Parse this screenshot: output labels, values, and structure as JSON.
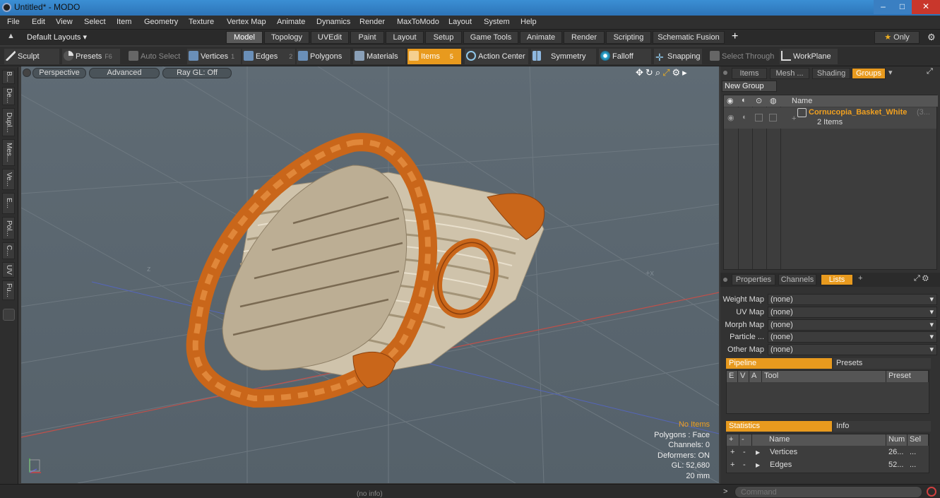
{
  "window": {
    "title": "Untitled* - MODO",
    "min": "–",
    "max": "□",
    "close": "✕"
  },
  "menu": [
    "File",
    "Edit",
    "View",
    "Select",
    "Item",
    "Geometry",
    "Texture",
    "Vertex Map",
    "Animate",
    "Dynamics",
    "Render",
    "MaxToModo",
    "Layout",
    "System",
    "Help"
  ],
  "layouts": {
    "label": "Default Layouts",
    "tabs": [
      "Model",
      "Topology",
      "UVEdit",
      "Paint",
      "Layout",
      "Setup",
      "Game Tools",
      "Animate",
      "Render",
      "Scripting",
      "Schematic Fusion"
    ],
    "add": "+",
    "only": "Only"
  },
  "toolbar": {
    "sculpt": "Sculpt",
    "presets": "Presets",
    "presets_key": "F6",
    "auto_select": "Auto Select",
    "vertices": "Vertices",
    "vertices_n": "1",
    "edges": "Edges",
    "edges_n": "2",
    "polygons": "Polygons",
    "materials": "Materials",
    "items": "Items",
    "items_n": "5",
    "action_center": "Action Center",
    "symmetry": "Symmetry",
    "falloff": "Falloff",
    "snapping": "Snapping",
    "select_through": "Select Through",
    "workplane": "WorkPlane"
  },
  "left_tabs": [
    "B...",
    "De...",
    "Dupl...",
    "Mes...",
    "Ve...",
    "E...",
    "Pol...",
    "C...",
    "UV",
    "Fu..."
  ],
  "viewport": {
    "view": "Perspective",
    "mode": "Advanced",
    "raygl": "Ray GL: Off",
    "axis_z": "z",
    "axis_x": "+x",
    "stats": {
      "items": "No Items",
      "polygons": "Polygons : Face",
      "channels": "Channels: 0",
      "deformers": "Deformers: ON",
      "gl": "GL: 52,680",
      "unit": "20 mm"
    }
  },
  "status": {
    "info": "(no info)",
    "command_placeholder": "Command"
  },
  "groups_panel": {
    "tabs": [
      "Items",
      "Mesh ...",
      "Shading",
      "Groups"
    ],
    "new_group": "New Group",
    "col_name": "Name",
    "group_name": "Cornucopia_Basket_White",
    "group_suffix": "(3...",
    "group_count": "2 Items"
  },
  "props_panel": {
    "tabs": [
      "Properties",
      "Channels",
      "Lists"
    ],
    "rows": [
      {
        "label": "Weight Map",
        "value": "(none)"
      },
      {
        "label": "UV Map",
        "value": "(none)"
      },
      {
        "label": "Morph Map",
        "value": "(none)"
      },
      {
        "label": "Particle ...",
        "value": "(none)"
      },
      {
        "label": "Other Map",
        "value": "(none)"
      }
    ],
    "pipeline": "Pipeline",
    "presets": "Presets",
    "pipe_cols": [
      "E",
      "V",
      "A",
      "Tool",
      "Preset"
    ],
    "statistics": "Statistics",
    "info": "Info",
    "stat_cols": [
      "+",
      "-",
      "Name",
      "Num",
      "Sel"
    ],
    "stat_rows": [
      {
        "name": "Vertices",
        "num": "26...",
        "sel": "..."
      },
      {
        "name": "Edges",
        "num": "52...",
        "sel": "..."
      }
    ]
  },
  "colors": {
    "accent": "#e89a1e",
    "wicker_orange": "#c9661a",
    "wicker_cream": "#d8cdb6"
  }
}
